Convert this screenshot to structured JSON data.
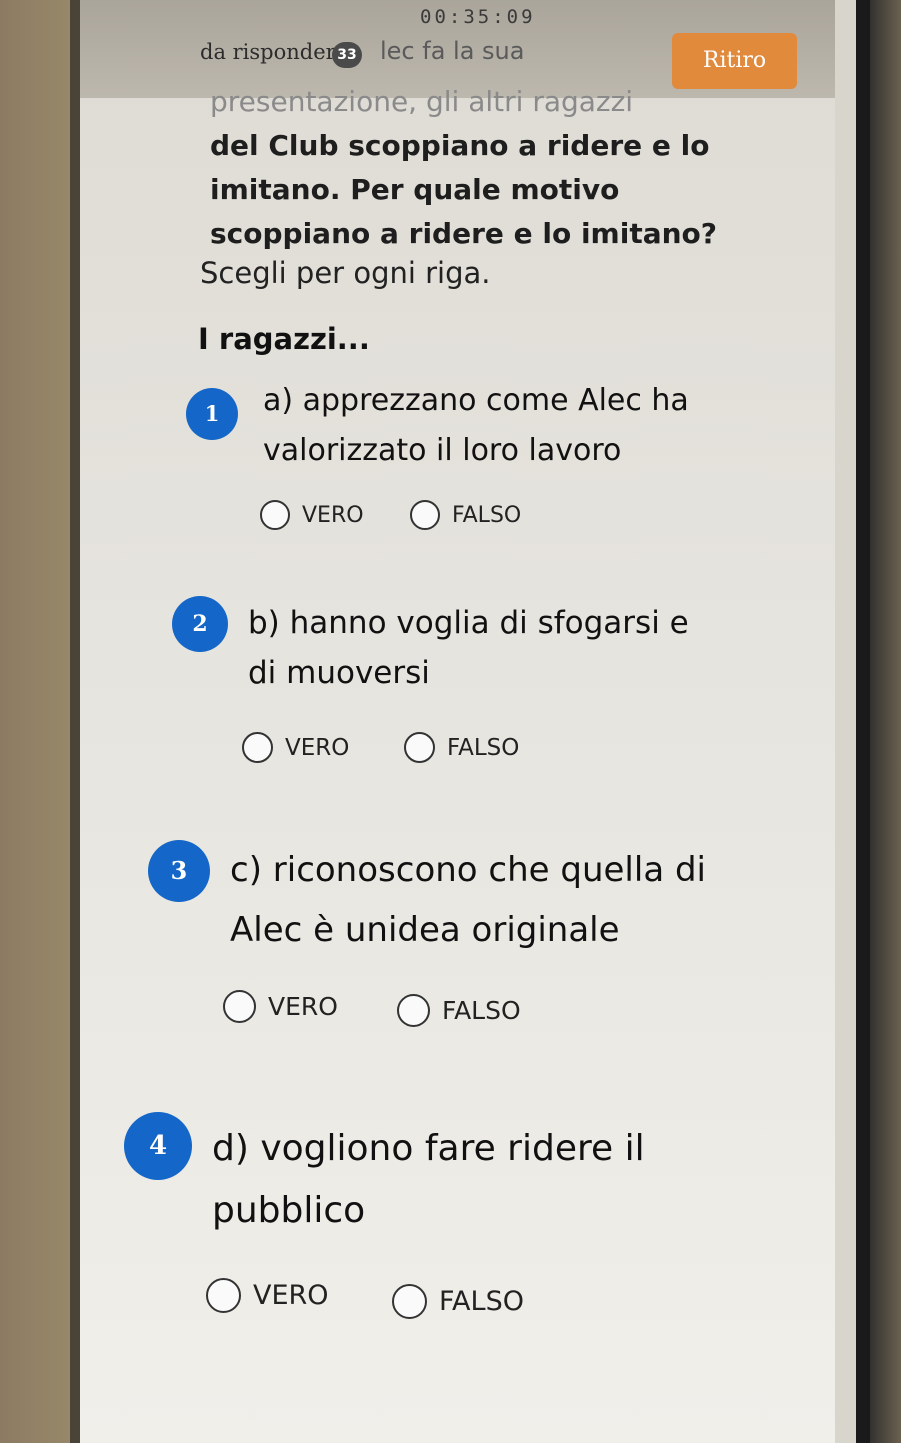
{
  "header": {
    "timer": "00:35:09",
    "to_answer_label": "da rispondere",
    "to_answer_count": "33",
    "retire_label": "Ritiro",
    "fragment_text": "lec fa la sua"
  },
  "question": {
    "line1": "presentazione, gli altri ragazzi",
    "line2": "del Club scoppiano a ridere e lo",
    "line3": "imitano. Per quale motivo",
    "line4": "scoppiano a ridere e lo imitano?",
    "instruction": "Scegli per ogni riga.",
    "stem": "I ragazzi..."
  },
  "items": [
    {
      "number": "1",
      "line1": "a) apprezzano come Alec ha",
      "line2": "valorizzato il loro lavoro",
      "true_label": "VERO",
      "false_label": "FALSO"
    },
    {
      "number": "2",
      "line1": "b) hanno voglia di sfogarsi e",
      "line2": "di muoversi",
      "true_label": "VERO",
      "false_label": "FALSO"
    },
    {
      "number": "3",
      "line1": "c) riconoscono che quella di",
      "line2": "Alec è unidea originale",
      "true_label": "VERO",
      "false_label": "FALSO"
    },
    {
      "number": "4",
      "line1": "d) vogliono fare ridere il",
      "line2": "pubblico",
      "true_label": "VERO",
      "false_label": "FALSO"
    }
  ],
  "colors": {
    "accent_blue": "#1467c8",
    "retire_orange": "#e18a3c"
  }
}
